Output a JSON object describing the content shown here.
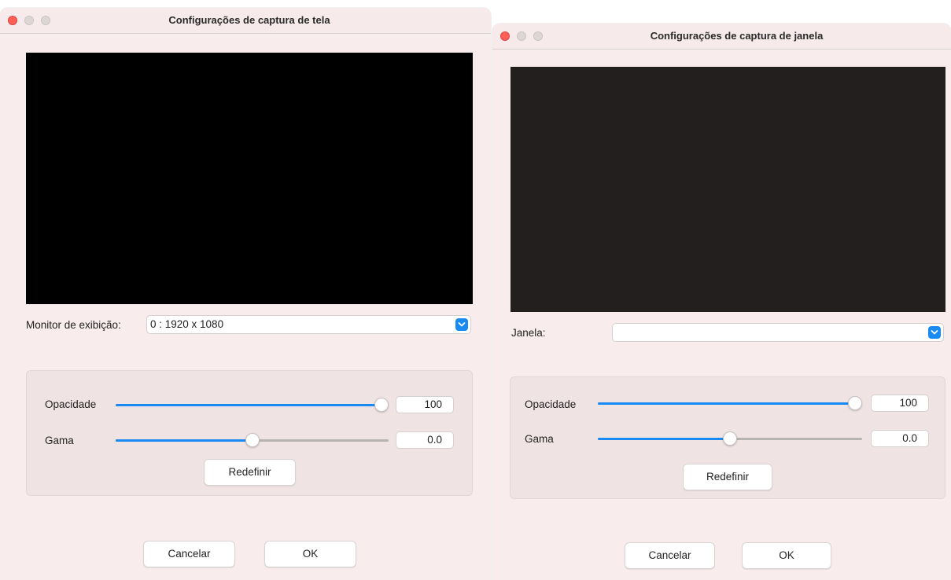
{
  "screen_window": {
    "title": "Configurações de captura de tela",
    "source_label": "Monitor de exibição:",
    "source_value": "0 : 1920 x 1080",
    "opacity_label": "Opacidade",
    "opacity_value": "100",
    "opacity_level": 1.0,
    "gamma_label": "Gama",
    "gamma_value": "0.0",
    "gamma_level": 0.5,
    "reset_label": "Redefinir",
    "cancel_label": "Cancelar",
    "ok_label": "OK"
  },
  "window_window": {
    "title": "Configurações de captura de janela",
    "source_label": "Janela:",
    "source_value": "",
    "opacity_label": "Opacidade",
    "opacity_value": "100",
    "opacity_level": 1.0,
    "gamma_label": "Gama",
    "gamma_value": "0.0",
    "gamma_level": 0.5,
    "reset_label": "Redefinir",
    "cancel_label": "Cancelar",
    "ok_label": "OK"
  },
  "icons": {
    "close": "close-icon",
    "minimize": "minimize-icon",
    "zoom": "zoom-icon",
    "dropdown": "chevron-down-icon"
  },
  "colors": {
    "accent": "#1a8af3",
    "close_light": "#ff5f57",
    "window_bg": "#f8ecec"
  }
}
